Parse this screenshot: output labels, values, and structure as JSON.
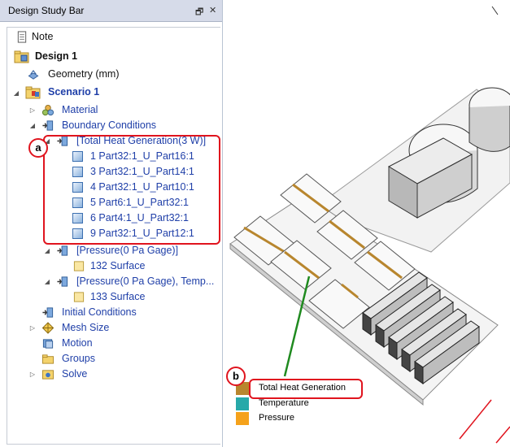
{
  "panel": {
    "title": "Design Study Bar",
    "pin_glyph": "🗗",
    "close_glyph": "✕"
  },
  "tree": {
    "note": "Note",
    "design": "Design 1",
    "geometry": "Geometry (mm)",
    "scenario": "Scenario 1",
    "material": "Material",
    "boundary": "Boundary Conditions",
    "total_heat": "[Total Heat Generation(3 W)]",
    "parts": [
      "1 Part32:1_U_Part16:1",
      "3 Part32:1_U_Part14:1",
      "4 Part32:1_U_Part10:1",
      "5 Part6:1_U_Part32:1",
      "6 Part4:1_U_Part32:1",
      "9 Part32:1_U_Part12:1"
    ],
    "pressure1": "[Pressure(0 Pa Gage)]",
    "surface132": "132 Surface",
    "pressure2": "[Pressure(0 Pa Gage), Temp...",
    "surface133": "133 Surface",
    "initial": "Initial Conditions",
    "mesh": "Mesh Size",
    "motion": "Motion",
    "groups": "Groups",
    "solve": "Solve"
  },
  "callouts": {
    "a": "a",
    "b": "b"
  },
  "legend": [
    {
      "label": "Total Heat Generation",
      "color": "#b8862e"
    },
    {
      "label": "Temperature",
      "color": "#27a9a9"
    },
    {
      "label": "Pressure",
      "color": "#f5a21b"
    }
  ],
  "colors": {
    "callout": "#e0141e",
    "tree_blue": "#1f3fa8",
    "leader": "#1f8a1f",
    "heat_strip": "#b8862e"
  }
}
